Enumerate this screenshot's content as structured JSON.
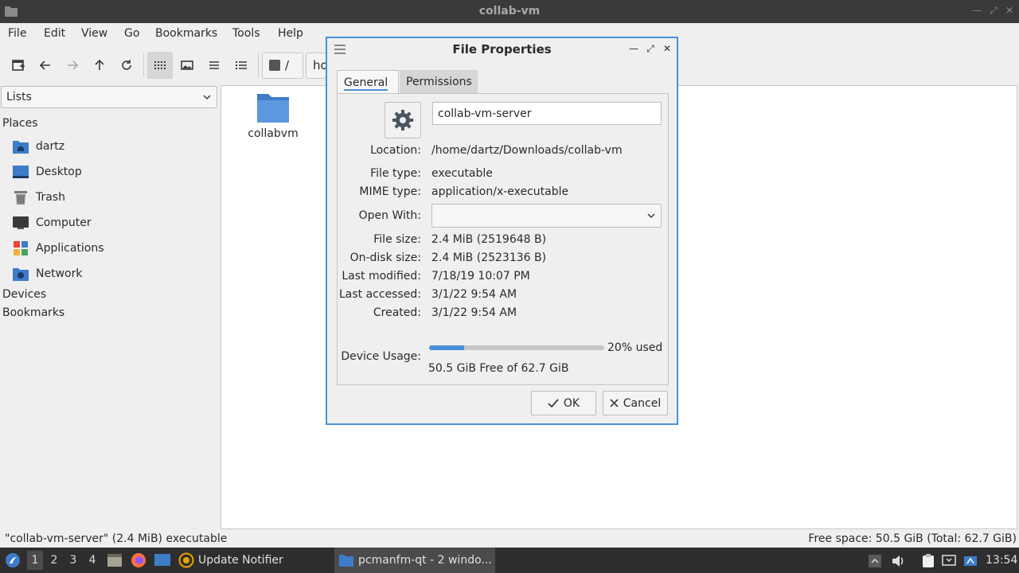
{
  "window": {
    "title": "collab-vm"
  },
  "menu": [
    "File",
    "Edit",
    "View",
    "Go",
    "Bookmarks",
    "Tools",
    "Help"
  ],
  "toolbar": {
    "buttons": [
      "new-tab-icon",
      "back-icon",
      "forward-icon",
      "up-icon",
      "reload-icon",
      "icon-view-icon",
      "thumbnail-view-icon",
      "compact-view-icon",
      "detailed-list-icon"
    ],
    "path_root": "/",
    "path_segment": "ho"
  },
  "sidebar": {
    "selector": "Lists",
    "places_label": "Places",
    "items": [
      {
        "label": "dartz",
        "icon": "home-folder-icon"
      },
      {
        "label": "Desktop",
        "icon": "desktop-icon"
      },
      {
        "label": "Trash",
        "icon": "trash-icon"
      },
      {
        "label": "Computer",
        "icon": "computer-icon"
      },
      {
        "label": "Applications",
        "icon": "applications-icon"
      },
      {
        "label": "Network",
        "icon": "network-icon"
      }
    ],
    "devices_label": "Devices",
    "bookmarks_label": "Bookmarks"
  },
  "files": [
    {
      "name": "collabvm",
      "icon": "folder-icon"
    }
  ],
  "status": {
    "left": "\"collab-vm-server\" (2.4 MiB) executable",
    "right": "Free space: 50.5 GiB (Total: 62.7 GiB)"
  },
  "dialog": {
    "title": "File Properties",
    "tabs": [
      "General",
      "Permissions"
    ],
    "name_value": "collab-vm-server",
    "rows": [
      {
        "label": "Location:",
        "value": "/home/dartz/Downloads/collab-vm"
      },
      {
        "label": "File type:",
        "value": "executable"
      },
      {
        "label": "MIME type:",
        "value": "application/x-executable"
      },
      {
        "label": "Open With:",
        "value": ""
      },
      {
        "label": "File size:",
        "value": "2.4 MiB (2519648 B)"
      },
      {
        "label": "On-disk size:",
        "value": "2.4 MiB (2523136 B)"
      },
      {
        "label": "Last modified:",
        "value": "7/18/19 10:07 PM"
      },
      {
        "label": "Last accessed:",
        "value": "3/1/22 9:54 AM"
      },
      {
        "label": "Created:",
        "value": "3/1/22 9:54 AM"
      }
    ],
    "usage_label": "Device Usage:",
    "usage_fraction": 0.2,
    "usage_text": "20% used",
    "free_text": "50.5 GiB Free of 62.7 GiB",
    "ok_label": "OK",
    "cancel_label": "Cancel"
  },
  "panel": {
    "workspaces": [
      "1",
      "2",
      "3",
      "4"
    ],
    "active_workspace": "1",
    "tasks": [
      {
        "label": "Update Notifier",
        "icon": "update-notifier-icon"
      },
      {
        "label": "pcmanfm-qt - 2 windo...",
        "icon": "folder-icon"
      }
    ],
    "clock": "13:54"
  },
  "colors": {
    "accent": "#4a90d9",
    "panel_bg": "#2e2e2e",
    "titlebar_bg": "#3a3a3a"
  }
}
